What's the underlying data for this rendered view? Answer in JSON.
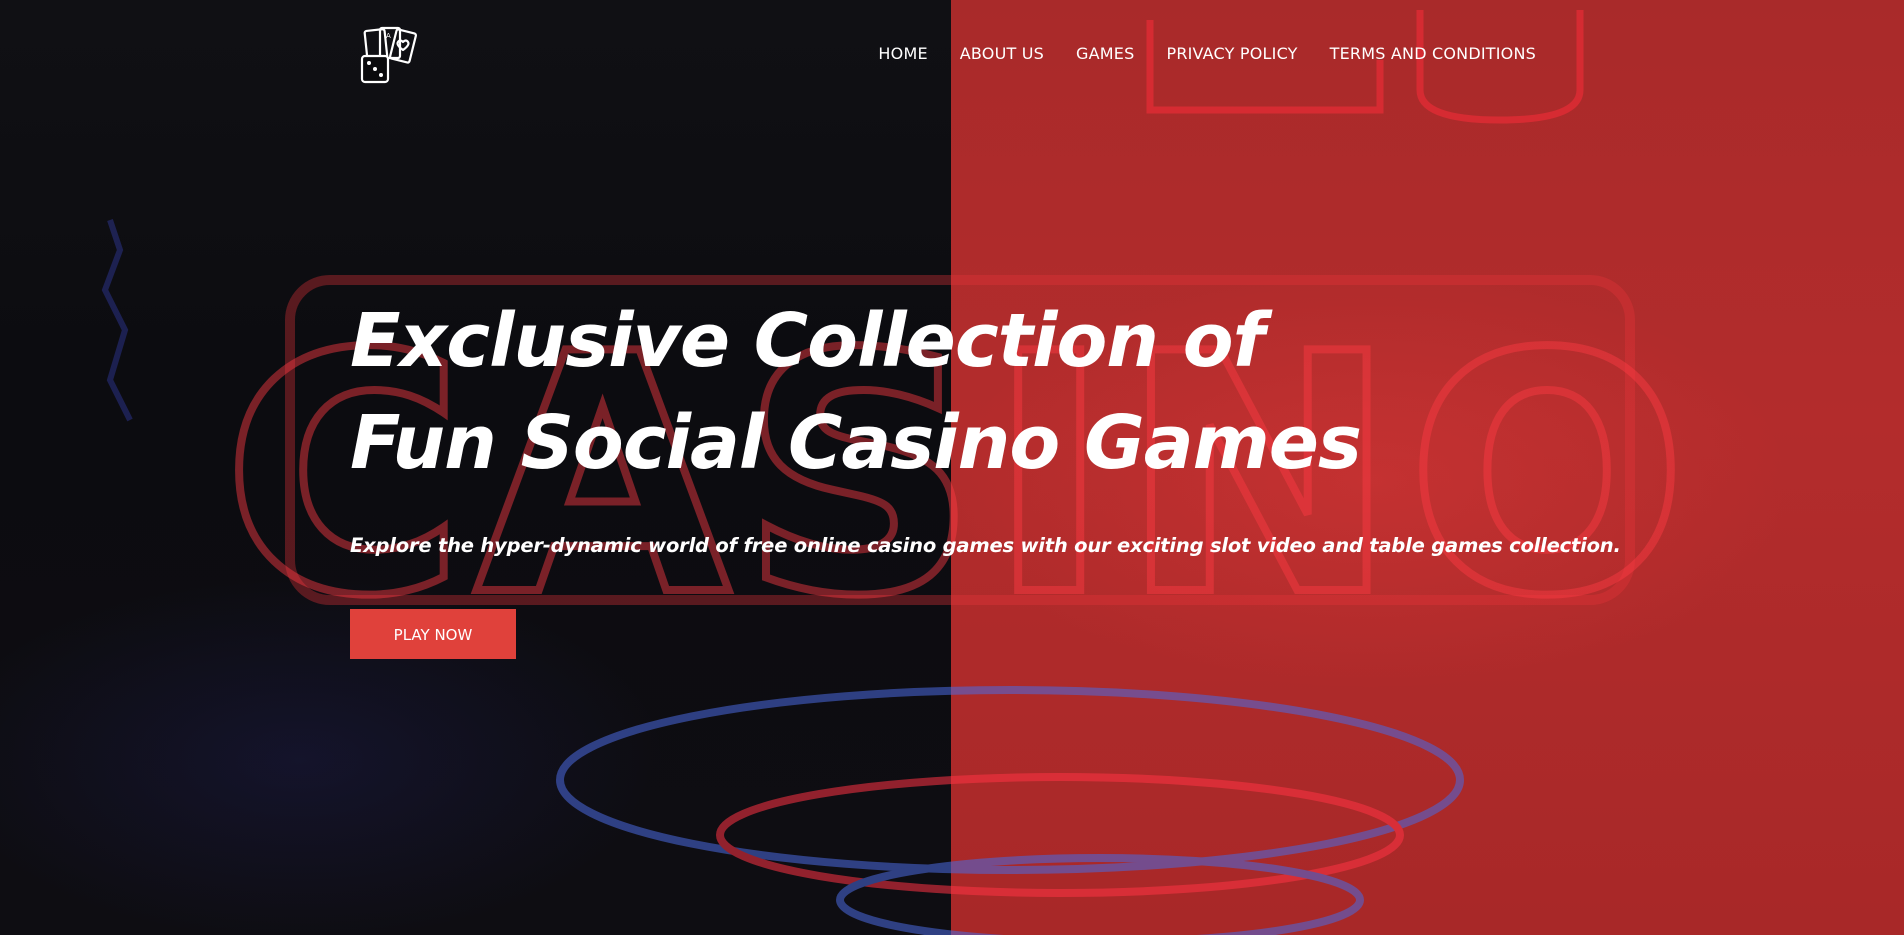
{
  "header": {
    "logo_icon": "playing-cards-and-dice-icon",
    "nav": [
      {
        "label": "HOME"
      },
      {
        "label": "ABOUT US"
      },
      {
        "label": "GAMES"
      },
      {
        "label": "PRIVACY POLICY"
      },
      {
        "label": "TERMS AND CONDITIONS"
      }
    ]
  },
  "hero": {
    "title_line1": "Exclusive Collection of",
    "title_line2": "Fun Social Casino Games",
    "subtitle": "Explore the hyper-dynamic world of free online casino games with our exciting slot video and table games collection.",
    "cta_label": "PLAY NOW",
    "background_sign_text": "CASINO"
  },
  "colors": {
    "accent": "#e0413b",
    "right_overlay": "#b02b2b",
    "dark_bg": "#0c0c10",
    "text": "#ffffff"
  }
}
